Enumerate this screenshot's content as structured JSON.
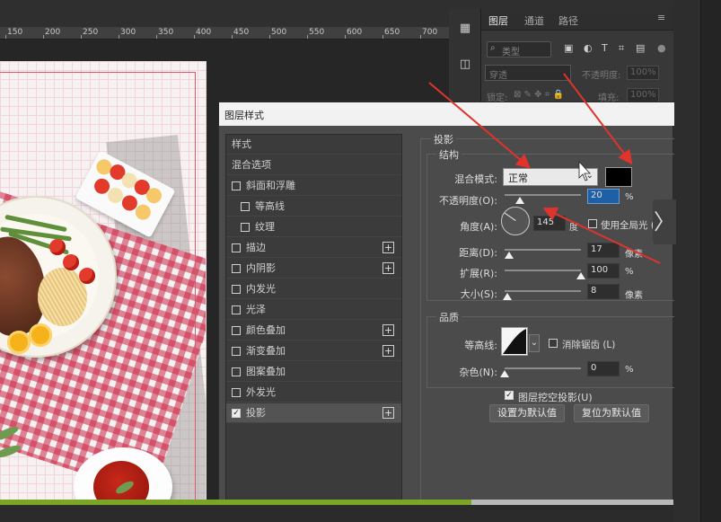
{
  "ruler": {
    "ticks": [
      "150",
      "200",
      "250",
      "300",
      "350",
      "400",
      "450",
      "500",
      "550",
      "600",
      "650",
      "700"
    ]
  },
  "toolstrip": {
    "icons": [
      "layers-panel-icon",
      "channels-panel-icon"
    ]
  },
  "layers_panel": {
    "tabs": [
      {
        "label": "图层",
        "active": true
      },
      {
        "label": "通道",
        "active": false
      },
      {
        "label": "路径",
        "active": false
      }
    ],
    "filter_placeholder": "类型",
    "blend_mode": "穿透",
    "opacity_label": "不透明度:",
    "opacity_value": "100%",
    "lock_label": "锁定:",
    "fill_label": "填充:",
    "fill_value": "100%"
  },
  "dialog": {
    "title": "图层样式",
    "styles": [
      {
        "label": "样式",
        "checkbox": false,
        "plus": false,
        "checked": false,
        "indent": 0
      },
      {
        "label": "混合选项",
        "checkbox": false,
        "plus": false,
        "checked": false,
        "indent": 0
      },
      {
        "label": "斜面和浮雕",
        "checkbox": true,
        "plus": false,
        "checked": false,
        "indent": 0
      },
      {
        "label": "等高线",
        "checkbox": true,
        "plus": false,
        "checked": false,
        "indent": 1
      },
      {
        "label": "纹理",
        "checkbox": true,
        "plus": false,
        "checked": false,
        "indent": 1
      },
      {
        "label": "描边",
        "checkbox": true,
        "plus": true,
        "checked": false,
        "indent": 0
      },
      {
        "label": "内阴影",
        "checkbox": true,
        "plus": true,
        "checked": false,
        "indent": 0
      },
      {
        "label": "内发光",
        "checkbox": true,
        "plus": false,
        "checked": false,
        "indent": 0
      },
      {
        "label": "光泽",
        "checkbox": true,
        "plus": false,
        "checked": false,
        "indent": 0
      },
      {
        "label": "颜色叠加",
        "checkbox": true,
        "plus": true,
        "checked": false,
        "indent": 0
      },
      {
        "label": "渐变叠加",
        "checkbox": true,
        "plus": true,
        "checked": false,
        "indent": 0
      },
      {
        "label": "图案叠加",
        "checkbox": true,
        "plus": false,
        "checked": false,
        "indent": 0
      },
      {
        "label": "外发光",
        "checkbox": true,
        "plus": false,
        "checked": false,
        "indent": 0
      },
      {
        "label": "投影",
        "checkbox": true,
        "plus": true,
        "checked": true,
        "indent": 0
      }
    ],
    "section_title": "投影",
    "structure": {
      "group_label": "结构",
      "blend_label": "混合模式:",
      "blend_value": "正常",
      "shadow_color": "#000000",
      "opacity_label": "不透明度(O):",
      "opacity_value": "20",
      "opacity_unit": "%",
      "opacity_level": 0.2,
      "angle_label": "角度(A):",
      "angle_value": "145",
      "angle_unit": "度",
      "global_light_label": "使用全局光 (G)",
      "distance_label": "距离(D):",
      "distance_value": "17",
      "distance_unit": "像素",
      "distance_level": 0.06,
      "spread_label": "扩展(R):",
      "spread_value": "100",
      "spread_unit": "%",
      "spread_level": 1.0,
      "size_label": "大小(S):",
      "size_value": "8",
      "size_unit": "像素",
      "size_level": 0.03
    },
    "quality": {
      "group_label": "品质",
      "contour_label": "等高线:",
      "antialias_label": "消除锯齿 (L)",
      "noise_label": "杂色(N):",
      "noise_value": "0",
      "noise_unit": "%",
      "noise_level": 0.0
    },
    "knockout_label": "图层挖空投影(U)",
    "knockout_checked": true,
    "set_default_label": "设置为默认值",
    "reset_default_label": "复位为默认值"
  },
  "colors": {
    "accent_progress": "#7aa526",
    "cloth_red": "#cd2846",
    "highlight_value": "#1f5fa6",
    "annotation_arrow": "#e0332c"
  },
  "video_progress": 0.7
}
